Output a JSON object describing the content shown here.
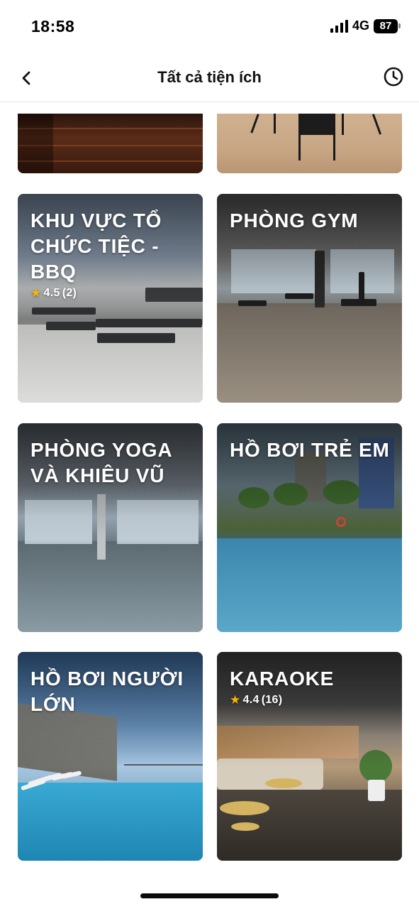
{
  "status_bar": {
    "time": "18:58",
    "network": "4G",
    "battery": "87"
  },
  "header": {
    "title": "Tất cả tiện ích",
    "back_icon": "chevron-left-icon",
    "history_icon": "clock-icon"
  },
  "amenities": [
    {
      "id": "bbq",
      "title": "KHU VỰC TỔ CHỨC TIỆC - BBQ",
      "rating": "4.5",
      "review_count": "(2)"
    },
    {
      "id": "gym",
      "title": "PHÒNG GYM"
    },
    {
      "id": "yoga",
      "title": "PHÒNG YOGA VÀ KHIÊU VŨ"
    },
    {
      "id": "kids-pool",
      "title": "HỒ BƠI TRẺ EM"
    },
    {
      "id": "adult-pool",
      "title": "HỒ BƠI NGƯỜI LỚN"
    },
    {
      "id": "karaoke",
      "title": "KARAOKE",
      "rating": "4.4",
      "review_count": "(16)"
    }
  ],
  "colors": {
    "star": "#f5b800",
    "background": "#ffffff",
    "title_text": "#ffffff"
  }
}
